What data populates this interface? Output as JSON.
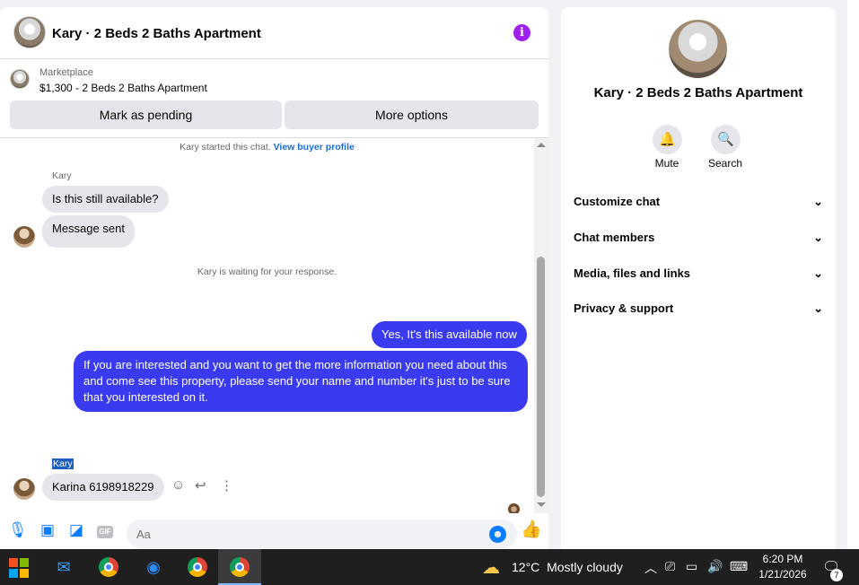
{
  "chat": {
    "title": "Kary · 2 Beds 2 Baths Apartment",
    "marketplace_label": "Marketplace",
    "listing": "$1,300 - 2 Beds 2 Baths Apartment",
    "btn_pending": "Mark as pending",
    "btn_more": "More options",
    "started_text": "Kary started this chat.",
    "view_profile": "View buyer profile",
    "sender_name_1": "Kary",
    "msg_1": "Is this still available?",
    "msg_2": "Message sent",
    "waiting_text": "Kary is waiting for your response.",
    "out_1": "Yes, It's this available now",
    "out_2": "If you are interested and you want to get the more information you need about this and come see this property, please send your name and number it's just to be sure that you interested on it.",
    "sender_name_2": "Kary",
    "msg_3": "Karina 6198918229",
    "composer_placeholder": "Aa",
    "gif_label": "GIF"
  },
  "info": {
    "title": "Kary · 2 Beds 2 Baths Apartment",
    "mute": "Mute",
    "search": "Search",
    "sections": [
      "Customize chat",
      "Chat members",
      "Media, files and links",
      "Privacy & support"
    ]
  },
  "taskbar": {
    "temperature": "12°C",
    "weather": "Mostly cloudy",
    "time": "6:20 PM",
    "date": "1/21/2026",
    "notifications": "7"
  },
  "colors": {
    "accent": "#0a7cff",
    "outgoing_bubble": "#3a3af0",
    "info_icon": "#a020f0"
  },
  "icons": [
    "info-icon",
    "bell-icon",
    "search-icon",
    "chevron-down-icon",
    "microphone-icon",
    "photo-icon",
    "sticker-icon",
    "gif-icon",
    "emoji-icon",
    "thumbs-up-icon",
    "smiley-icon",
    "reply-icon",
    "more-icon",
    "windows-icon",
    "mail-icon",
    "chrome-icon",
    "edge-icon",
    "weather-icon",
    "chevron-up-icon",
    "camera-icon",
    "network-icon",
    "volume-icon",
    "keyboard-icon",
    "notification-icon"
  ]
}
